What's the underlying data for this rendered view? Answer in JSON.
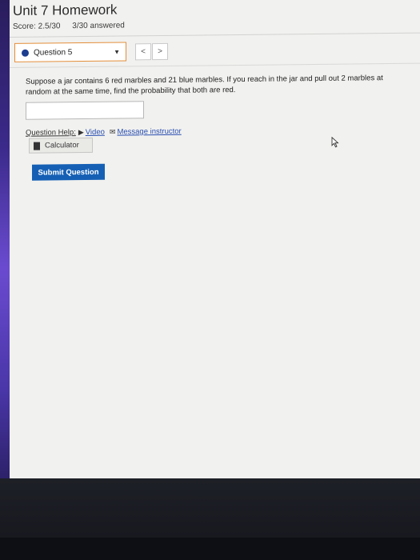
{
  "header": {
    "title": "Unit 7 Homework",
    "score": "Score: 2.5/30",
    "answered": "3/30 answered"
  },
  "question_nav": {
    "selected": "Question 5",
    "prev_label": "<",
    "next_label": ">"
  },
  "question": {
    "text": "Suppose a jar contains 6 red marbles and 21 blue marbles. If you reach in the jar and pull out 2 marbles at random at the same time, find the probability that both are red.",
    "answer_value": ""
  },
  "help": {
    "label": "Question Help:",
    "video": "Video",
    "message": "Message instructor",
    "calculator": "Calculator"
  },
  "submit_label": "Submit Question",
  "colors": {
    "submit_bg": "#1560b5",
    "selector_border": "#e38e3a",
    "link": "#2a4fb0"
  }
}
